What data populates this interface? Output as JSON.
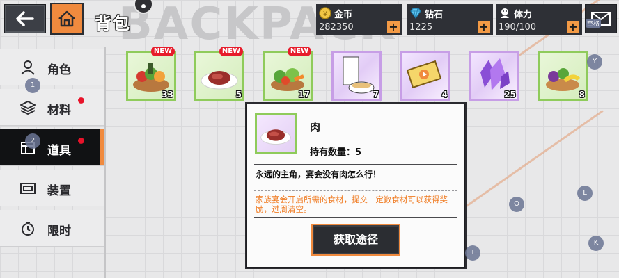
{
  "header": {
    "title": "背包",
    "watermark": "BACKPACK",
    "resources": [
      {
        "label": "金币",
        "value": "282350",
        "icon": "coin-icon",
        "plus": "+"
      },
      {
        "label": "钻石",
        "value": "1225",
        "icon": "diamond-icon",
        "plus": "+"
      },
      {
        "label": "体力",
        "value": "190/100",
        "icon": "stamina-icon",
        "plus": "+"
      }
    ],
    "mail_label": "空格"
  },
  "sidebar": {
    "items": [
      {
        "label": "角色",
        "icon": "person-icon",
        "active": false,
        "dot": false
      },
      {
        "label": "材料",
        "icon": "layers-icon",
        "active": false,
        "dot": true
      },
      {
        "label": "道具",
        "icon": "item-box-icon",
        "active": true,
        "dot": true
      },
      {
        "label": "装置",
        "icon": "device-icon",
        "active": false,
        "dot": false
      },
      {
        "label": "限时",
        "icon": "timer-icon",
        "active": false,
        "dot": false
      }
    ]
  },
  "items": [
    {
      "name": "food-basket",
      "count": "33",
      "new": "NEW",
      "rarity": "green"
    },
    {
      "name": "steak",
      "count": "5",
      "new": "NEW",
      "rarity": "green"
    },
    {
      "name": "vegetables",
      "count": "17",
      "new": "NEW",
      "rarity": "green"
    },
    {
      "name": "noodle-soup",
      "count": "7",
      "new": "",
      "rarity": "purple"
    },
    {
      "name": "ticket",
      "count": "4",
      "new": "",
      "rarity": "purple"
    },
    {
      "name": "crystal",
      "count": "25",
      "new": "",
      "rarity": "purple"
    },
    {
      "name": "fruit-bowl",
      "count": "8",
      "new": "",
      "rarity": "green"
    }
  ],
  "popup": {
    "name": "肉",
    "held_label": "持有数量：",
    "held_value": "5",
    "description": "永远的主角，宴会没有肉怎么行！",
    "hint": "家族宴会开启所需的食材，提交一定数食材可以获得奖励，过周清空。",
    "button": "获取途径"
  },
  "key_hints": [
    "Y",
    "1",
    "2",
    "L",
    "O",
    "K",
    "I"
  ]
}
